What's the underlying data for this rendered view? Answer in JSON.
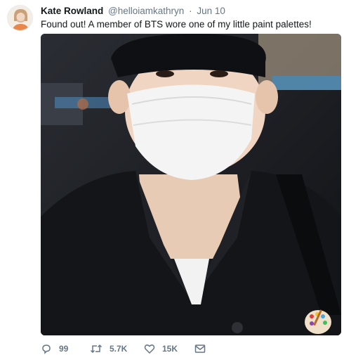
{
  "tweet": {
    "display_name": "Kate Rowland",
    "handle": "@helloiamkathryn",
    "separator": "·",
    "date": "Jun 10",
    "text": "Found out! A member of BTS wore one of my little paint palettes!"
  },
  "actions": {
    "reply_count": "99",
    "retweet_count": "5.7K",
    "like_count": "15K"
  },
  "icons": {
    "reply": "reply-icon",
    "retweet": "retweet-icon",
    "like": "heart-icon",
    "dm": "envelope-icon"
  },
  "colors": {
    "text_primary": "#14171a",
    "text_secondary": "#657786",
    "background": "#ffffff"
  }
}
